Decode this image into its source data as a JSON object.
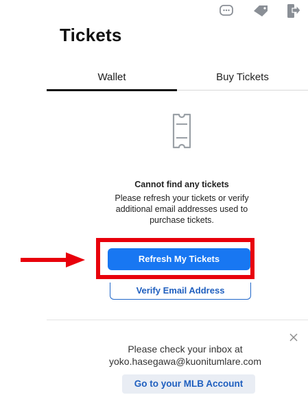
{
  "header": {
    "title": "Tickets",
    "icons": [
      "chat-bubble-icon",
      "tag-icon",
      "transfer-icon"
    ]
  },
  "tabs": [
    {
      "label": "Wallet",
      "selected": true
    },
    {
      "label": "Buy Tickets",
      "selected": false
    }
  ],
  "empty_state": {
    "icon": "ticket-icon",
    "title": "Cannot find any tickets",
    "description": "Please refresh your tickets or verify\nadditional email addresses used to\npurchase tickets."
  },
  "buttons": {
    "refresh_label": "Refresh My Tickets",
    "verify_label": "Verify Email Address"
  },
  "annotation": {
    "highlight_color": "#e8000b",
    "arrow_color": "#e8000b"
  },
  "notice": {
    "message": "Please check your inbox at\nyoko.hasegawa@kuonitumlare.com",
    "account_label": "Go to your MLB Account",
    "close_icon": "close-icon"
  },
  "colors": {
    "primary": "#1877f2",
    "link": "#1f5fbf"
  }
}
